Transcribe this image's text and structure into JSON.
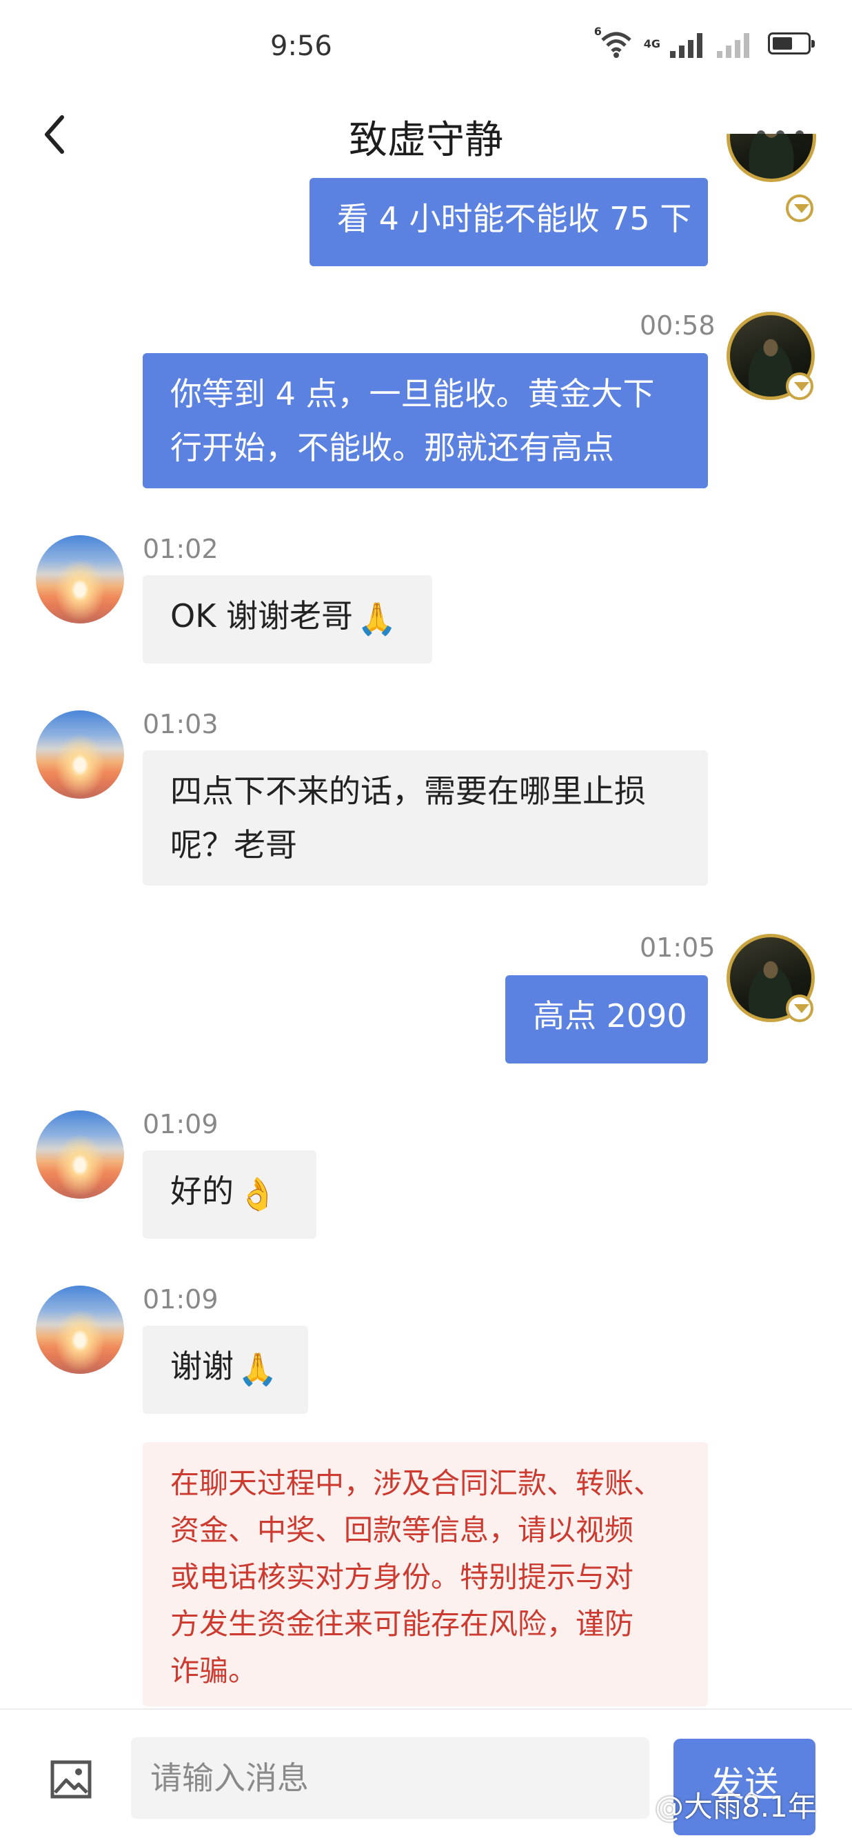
{
  "status_bar": {
    "time": "9:56",
    "wifi_label": "6",
    "network_label": "4G",
    "icons": [
      "wifi-icon",
      "signal-icon",
      "signal-icon",
      "battery-icon"
    ]
  },
  "header": {
    "title": "致虚守静",
    "back_icon": "chevron-left-icon",
    "more_icon": "more-icon"
  },
  "messages": [
    {
      "from": "me",
      "text": "看 4 小时能不能收 75 下"
    },
    {
      "from": "me",
      "time": "00:58",
      "lines": [
        "你等到 4 点，一旦能收。黄金大下",
        "行开始，不能收。那就还有高点"
      ]
    },
    {
      "from": "them",
      "time": "01:02",
      "text": "OK 谢谢老哥",
      "emoji": "🙏"
    },
    {
      "from": "them",
      "time": "01:03",
      "lines": [
        "四点下不来的话，需要在哪里止损",
        "呢？老哥"
      ]
    },
    {
      "from": "me",
      "time": "01:05",
      "text": "高点 2090"
    },
    {
      "from": "them",
      "time": "01:09",
      "text": "好的",
      "emoji": "👌"
    },
    {
      "from": "them",
      "time": "01:09",
      "text": "谢谢",
      "emoji": "🙏"
    }
  ],
  "warning": {
    "lines": [
      "在聊天过程中，涉及合同汇款、转账、",
      "资金、中奖、回款等信息，请以视频",
      "或电话核实对方身份。特别提示与对",
      "方发生资金往来可能存在风险，谨防",
      "诈骗。"
    ]
  },
  "input_bar": {
    "image_icon": "image-icon",
    "placeholder": "请输入消息",
    "value": "",
    "send_label": "发送"
  },
  "watermark": "@大雨8.1年",
  "colors": {
    "mine_bubble": "#5b82e0",
    "their_bubble": "#f2f2f2",
    "warning_text": "#cc3a30",
    "warning_bg": "#fdf1ef"
  }
}
